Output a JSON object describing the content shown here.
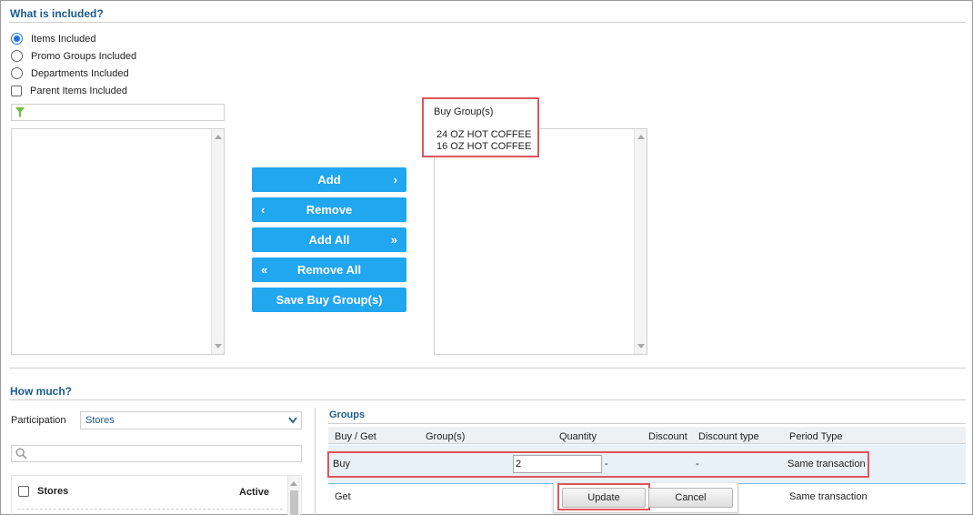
{
  "included": {
    "title": "What is included?",
    "options": [
      {
        "label": "Items Included",
        "type": "radio",
        "checked": true
      },
      {
        "label": "Promo Groups Included",
        "type": "radio",
        "checked": false
      },
      {
        "label": "Departments Included",
        "type": "radio",
        "checked": false
      },
      {
        "label": "Parent Items Included",
        "type": "checkbox",
        "checked": false
      }
    ],
    "filter_icon": "funnel-icon"
  },
  "buttons": {
    "add": "Add",
    "remove": "Remove",
    "add_all": "Add All",
    "remove_all": "Remove All",
    "save": "Save Buy Group(s)"
  },
  "buy_group": {
    "label": "Buy Group(s)",
    "items": [
      "24 OZ HOT COFFEE",
      "16 OZ HOT COFFEE"
    ]
  },
  "how_much": {
    "title": "How much?",
    "participation_label": "Participation",
    "participation_value": "Stores",
    "stores_header": "Stores",
    "active_header": "Active"
  },
  "groups": {
    "title": "Groups",
    "columns": [
      "Buy / Get",
      "Group(s)",
      "Quantity",
      "Discount",
      "Discount type",
      "Period Type"
    ],
    "rows": [
      {
        "buy_get": "Buy",
        "quantity": "2",
        "discount": "-",
        "discount_type": "-",
        "period": "Same transaction"
      },
      {
        "buy_get": "Get",
        "period": "Same transaction"
      }
    ],
    "update_label": "Update",
    "cancel_label": "Cancel"
  },
  "colors": {
    "accent": "#21a6f0",
    "title": "#1a5b8e",
    "highlight": "#e0545c",
    "row_selected": "#e8f1f8"
  }
}
